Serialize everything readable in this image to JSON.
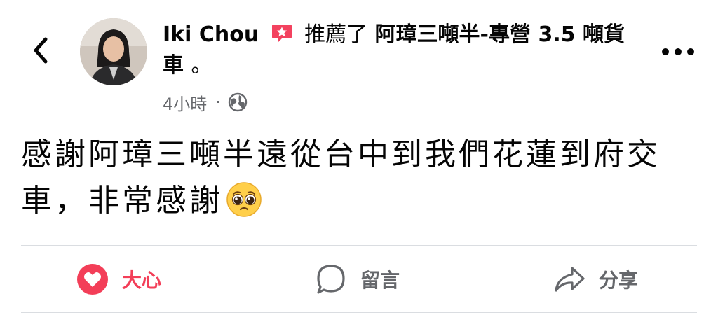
{
  "header": {
    "author_name": "Iki Chou",
    "action_text": "推薦了",
    "page_name": "阿璋三噸半-專營 3.5 噸貨車",
    "end_punct": "。",
    "time": "4小時",
    "dot": "·",
    "back_icon": "chevron-left-icon",
    "more_icon": "more-horizontal-icon",
    "privacy_icon": "globe-icon"
  },
  "post": {
    "text": "感謝阿璋三噸半遠從台中到我們花蓮到府交車，非常感謝",
    "emoji": "pleading-face"
  },
  "actions": {
    "like_label": "大心",
    "comment_label": "留言",
    "share_label": "分享"
  },
  "colors": {
    "love": "#f33e58",
    "recommend_badge": "#f3425f",
    "meta_gray": "#65676b",
    "divider": "#dadde1"
  }
}
